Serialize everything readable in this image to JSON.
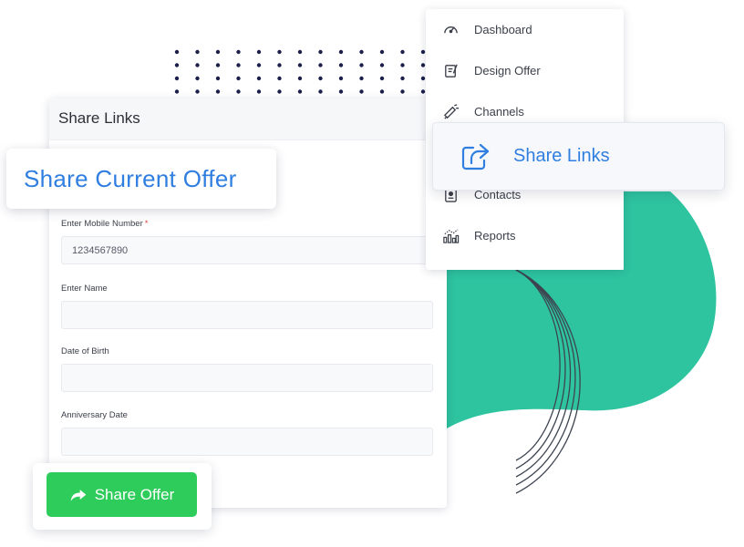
{
  "form": {
    "header_title": "Share Links",
    "mobile_label": "Enter Mobile Number",
    "required_mark": "*",
    "mobile_value": "1234567890",
    "name_label": "Enter Name",
    "name_value": "",
    "dob_label": "Date of Birth",
    "dob_value": "",
    "anniversary_label": "Anniversary Date",
    "anniversary_value": ""
  },
  "highlight": {
    "title": "Share Current Offer"
  },
  "share_button": {
    "label": "Share Offer",
    "color": "#2ecc5b"
  },
  "menu": {
    "items": [
      {
        "label": "Dashboard",
        "icon": "speedometer-icon"
      },
      {
        "label": "Design Offer",
        "icon": "design-offer-icon"
      },
      {
        "label": "Channels",
        "icon": "megaphone-icon"
      },
      {
        "label": "Share Links",
        "icon": "share-icon"
      },
      {
        "label": "Contacts",
        "icon": "contacts-icon"
      },
      {
        "label": "Reports",
        "icon": "reports-icon"
      }
    ],
    "active_label": "Share Links",
    "accent_color": "#2f7ee0"
  },
  "colors": {
    "blob": "#2ec4a0",
    "dots": "#1b1f4a",
    "accent": "#2f7ee0"
  }
}
